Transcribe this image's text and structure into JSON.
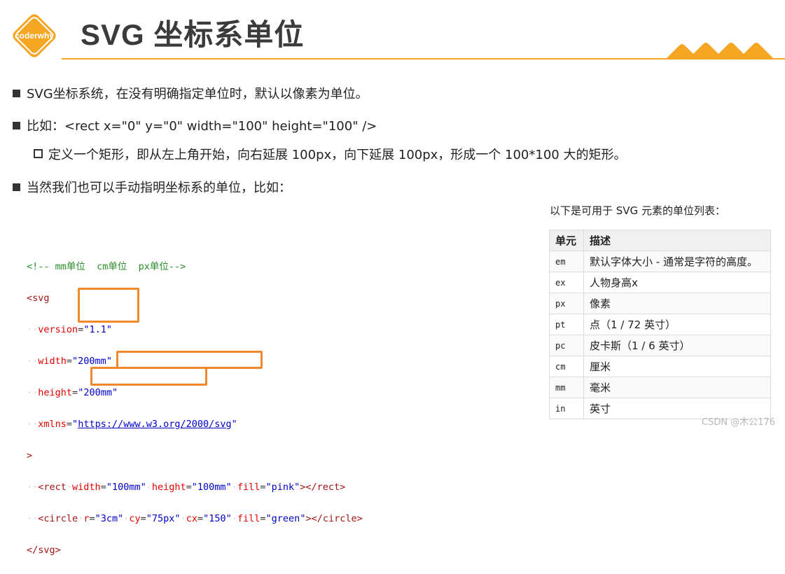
{
  "header": {
    "logo_text": "coderwhy",
    "title": "SVG 坐标系单位"
  },
  "colors": {
    "accent": "#f5a623",
    "highlight": "#f0892b",
    "title": "#3b3b3b"
  },
  "bullets": {
    "b1": "SVG坐标系统，在没有明确指定单位时，默认以像素为单位。",
    "b2": "比如：<rect x=\"0\" y=\"0\" width=\"100\" height=\"100\" />",
    "b2_sub": "定义一个矩形，即从左上角开始，向右延展 100px，向下延展 100px，形成一个 100*100 大的矩形。",
    "b3": "当然我们也可以手动指明坐标系的单位，比如："
  },
  "code": {
    "comment": "<!-- mm单位  cm单位  px单位-->",
    "svg_open": "<svg",
    "version_attr": "version",
    "version_val": "\"1.1\"",
    "width_attr": "width",
    "width_val": "\"200mm\"",
    "height_attr": "height",
    "height_val": "\"200mm\"",
    "xmlns_attr": "xmlns",
    "xmlns_val": "https://www.w3.org/2000/svg",
    "gt": ">",
    "rect_tag": "<rect",
    "rect_w_attr": "width",
    "rect_w_val": "\"100mm\"",
    "rect_h_attr": "height",
    "rect_h_val": "\"100mm\"",
    "fill_attr": "fill",
    "rect_fill_val": "\"pink\"",
    "rect_close": "></rect>",
    "circle_tag": "<circle",
    "r_attr": "r",
    "r_val": "\"3cm\"",
    "cy_attr": "cy",
    "cy_val": "\"75px\"",
    "cx_attr": "cx",
    "cx_val": "\"150\"",
    "circle_fill_val": "\"green\"",
    "circle_close": "></circle>",
    "svg_close": "</svg>"
  },
  "table": {
    "caption": "以下是可用于 SVG 元素的单位列表：",
    "headers": [
      "单元",
      "描述"
    ],
    "rows": [
      [
        "em",
        "默认字体大小 - 通常是字符的高度。"
      ],
      [
        "ex",
        "人物身高x"
      ],
      [
        "px",
        "像素"
      ],
      [
        "pt",
        "点（1 / 72 英寸）"
      ],
      [
        "pc",
        "皮卡斯（1 / 6 英寸）"
      ],
      [
        "cm",
        "厘米"
      ],
      [
        "mm",
        "毫米"
      ],
      [
        "in",
        "英寸"
      ]
    ]
  },
  "watermark": "CSDN @木公176"
}
